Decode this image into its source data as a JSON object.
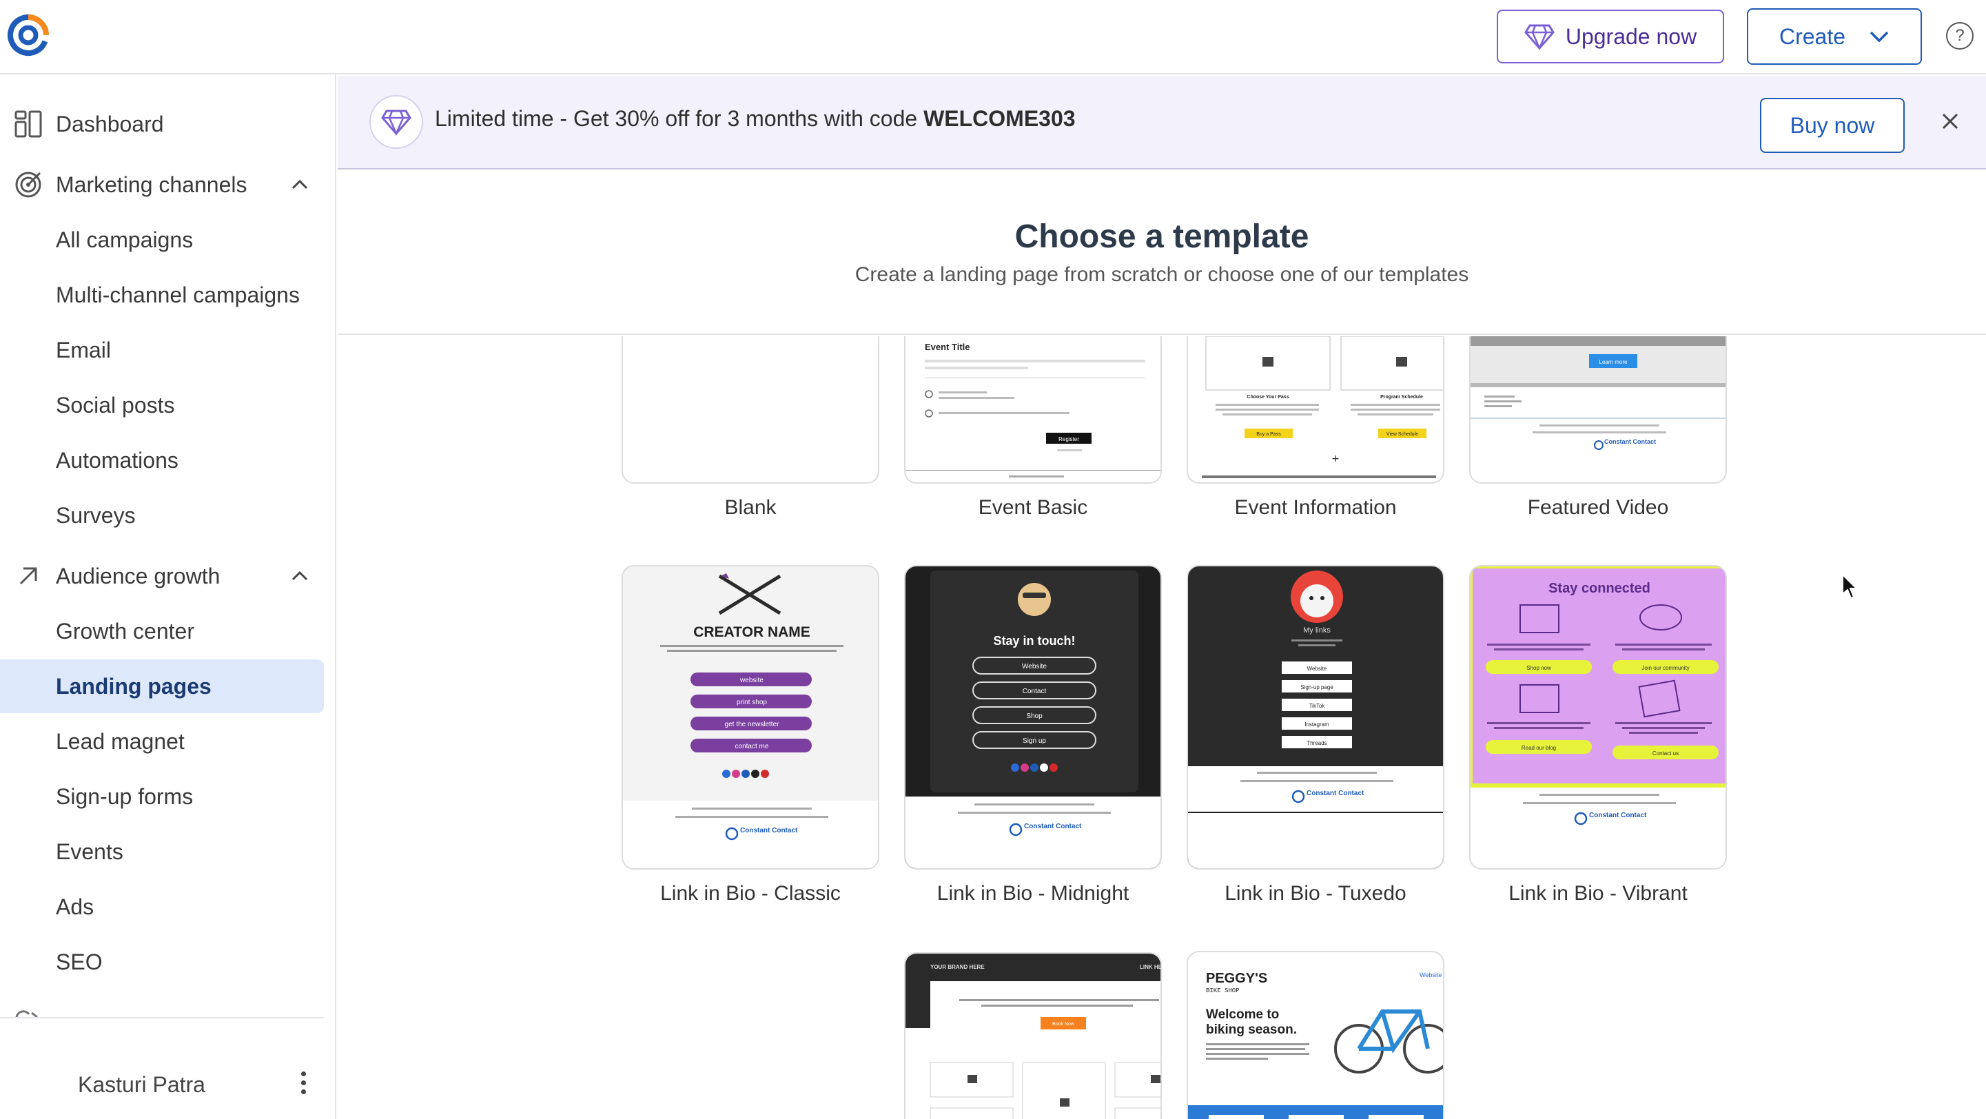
{
  "header": {
    "upgrade_label": "Upgrade now",
    "create_label": "Create",
    "help_icon": "?"
  },
  "sidebar": {
    "items": [
      {
        "label": "Dashboard"
      },
      {
        "label": "Marketing channels"
      },
      {
        "label": "All campaigns"
      },
      {
        "label": "Multi-channel campaigns"
      },
      {
        "label": "Email"
      },
      {
        "label": "Social posts"
      },
      {
        "label": "Automations"
      },
      {
        "label": "Surveys"
      },
      {
        "label": "Audience growth"
      },
      {
        "label": "Growth center"
      },
      {
        "label": "Landing pages"
      },
      {
        "label": "Lead magnet"
      },
      {
        "label": "Sign-up forms"
      },
      {
        "label": "Events"
      },
      {
        "label": "Ads"
      },
      {
        "label": "SEO"
      }
    ],
    "user_name": "Kasturi Patra"
  },
  "promo": {
    "text": "Limited time - Get 30% off for 3 months with code ",
    "code": "WELCOME303",
    "buy_label": "Buy now"
  },
  "page": {
    "title": "Choose a template",
    "subtitle": "Create a landing page from scratch or choose one of our templates"
  },
  "templates": [
    {
      "label": "Blank"
    },
    {
      "label": "Event Basic"
    },
    {
      "label": "Event Information"
    },
    {
      "label": "Featured Video"
    },
    {
      "label": "Link in Bio - Classic"
    },
    {
      "label": "Link in Bio - Midnight"
    },
    {
      "label": "Link in Bio - Tuxedo"
    },
    {
      "label": "Link in Bio - Vibrant"
    }
  ],
  "previews": {
    "event_basic": {
      "title": "Event Title",
      "register": "Register"
    },
    "event_info": {
      "left": "Choose Your Pass",
      "right": "Program Schedule",
      "btn_left": "Buy a Pass",
      "btn_right": "View Schedule"
    },
    "featured_video": {
      "learn_more": "Learn more",
      "brand": "Constant Contact"
    },
    "classic": {
      "name": "CREATOR NAME",
      "links": [
        "website",
        "print shop",
        "get the newsletter",
        "contact me"
      ],
      "brand": "Constant Contact"
    },
    "midnight": {
      "heading": "Stay in touch!",
      "links": [
        "Website",
        "Contact",
        "Shop",
        "Sign up"
      ],
      "brand": "Constant Contact"
    },
    "tuxedo": {
      "heading": "My links",
      "links": [
        "Website",
        "Sign-up page",
        "TikTok",
        "Instagram",
        "Threads"
      ],
      "brand": "Constant Contact"
    },
    "vibrant": {
      "heading": "Stay connected",
      "buttons": [
        "Shop now",
        "Join our community",
        "Read our blog",
        "Contact us"
      ],
      "brand": "Constant Contact"
    },
    "photographer": {
      "brand": "YOUR BRAND HERE",
      "link": "LINK HE",
      "cta": "Book Now"
    },
    "bike": {
      "brand": "PEGGY'S",
      "brand_sub": "BIKE SHOP",
      "nav": "Website",
      "headline": "Welcome to biking season."
    }
  },
  "colors": {
    "accent": "#1f5bb8",
    "upgrade": "#4b2e96",
    "active_nav_bg": "#dde9fb",
    "promo_bg": "#f3f1fb",
    "classic_purple": "#7b3fa0",
    "vibrant_bg": "#dba0f0",
    "vibrant_yellow": "#e7f23a"
  }
}
